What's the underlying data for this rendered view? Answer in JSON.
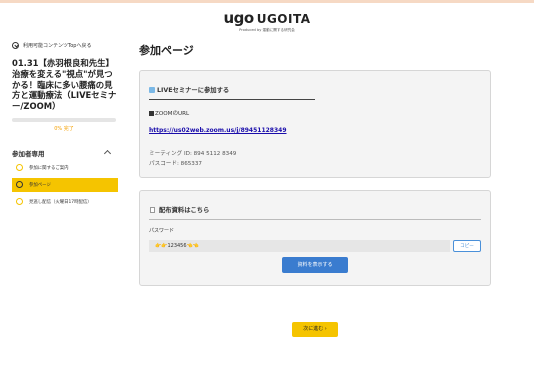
{
  "header": {
    "logo_mark": "ugo",
    "logo_text": "UGOITA",
    "logo_sub": "Produced by 運動に関する研究会"
  },
  "sidebar": {
    "back_label": "利用可能コンテンツTopへ戻る",
    "course_title": "01.31【赤羽根良和先生】治療を変える\"視点\"が見つかる！臨床に多い腰痛の見方と運動療法（LIVEセミナー/ZOOM）",
    "progress_percent": 0,
    "progress_text": "0% 完了",
    "section_label": "参加者専用",
    "lessons": [
      {
        "label": "参加に関するご案内",
        "active": false
      },
      {
        "label": "参加ページ",
        "active": true
      },
      {
        "label": "見逃し配信（火曜日17時配信）",
        "active": false
      }
    ]
  },
  "main": {
    "page_title": "参加ページ",
    "live_card": {
      "heading": "LIVEセミナーに参加する",
      "zoom_label": "ZOOMのURL",
      "zoom_url": "https://us02web.zoom.us/j/89451128349",
      "meeting_id": "ミーティング ID: 894 5112 8349",
      "passcode": "パスコード: 865337"
    },
    "materials_card": {
      "heading": "配布資料はこちら",
      "password_label": "パスワード",
      "password_value": "👉👉123456👈👈",
      "copy_label": "コピー",
      "show_label": "資料を表示する"
    },
    "next_label": "次に進む ›"
  },
  "colors": {
    "accent_yellow": "#f5c400",
    "button_blue": "#3a7ccf",
    "link_blue": "#1a0dab"
  }
}
